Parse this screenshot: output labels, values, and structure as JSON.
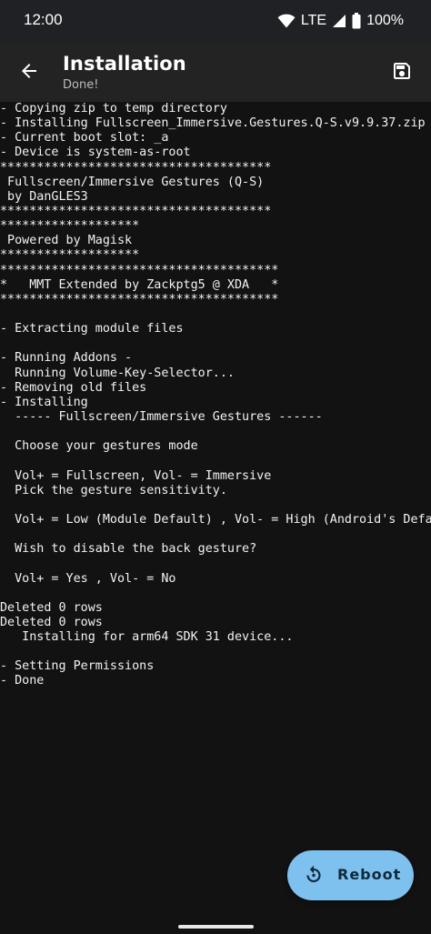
{
  "status_bar": {
    "time": "12:00",
    "network": "LTE",
    "battery": "100%",
    "icons": [
      "wifi-icon",
      "cellular-signal-icon",
      "battery-icon"
    ]
  },
  "app_bar": {
    "title": "Installation",
    "subtitle": "Done!",
    "back_icon": "arrow-left-icon",
    "save_icon": "save-icon"
  },
  "console": {
    "lines": [
      "- Copying zip to temp directory",
      "- Installing Fullscreen_Immersive.Gestures.Q-S.v9.9.37.zip",
      "- Current boot slot: _a",
      "- Device is system-as-root",
      "*************************************",
      " Fullscreen/Immersive Gestures (Q-S)",
      " by DanGLES3",
      "*************************************",
      "*******************",
      " Powered by Magisk",
      "*******************",
      "**************************************",
      "*   MMT Extended by Zackptg5 @ XDA   *",
      "**************************************",
      "",
      "- Extracting module files",
      "",
      "- Running Addons -",
      "  Running Volume-Key-Selector...",
      "- Removing old files",
      "- Installing",
      "  ----- Fullscreen/Immersive Gestures ------",
      "",
      "  Choose your gestures mode",
      "",
      "  Vol+ = Fullscreen, Vol- = Immersive",
      "  Pick the gesture sensitivity.",
      "",
      "  Vol+ = Low (Module Default) , Vol- = High (Android's Default)",
      "",
      "  Wish to disable the back gesture?",
      "",
      "  Vol+ = Yes , Vol- = No",
      "",
      "Deleted 0 rows",
      "Deleted 0 rows",
      "   Installing for arm64 SDK 31 device...",
      "",
      "- Setting Permissions",
      "- Done"
    ]
  },
  "fab": {
    "label": "Reboot",
    "icon": "restart-icon",
    "color": "#7ec0ee"
  },
  "colors": {
    "background": "#121212",
    "app_bar": "#232323",
    "status_bar": "#202124",
    "text": "#f2f2f2",
    "accent": "#7ec0ee"
  }
}
